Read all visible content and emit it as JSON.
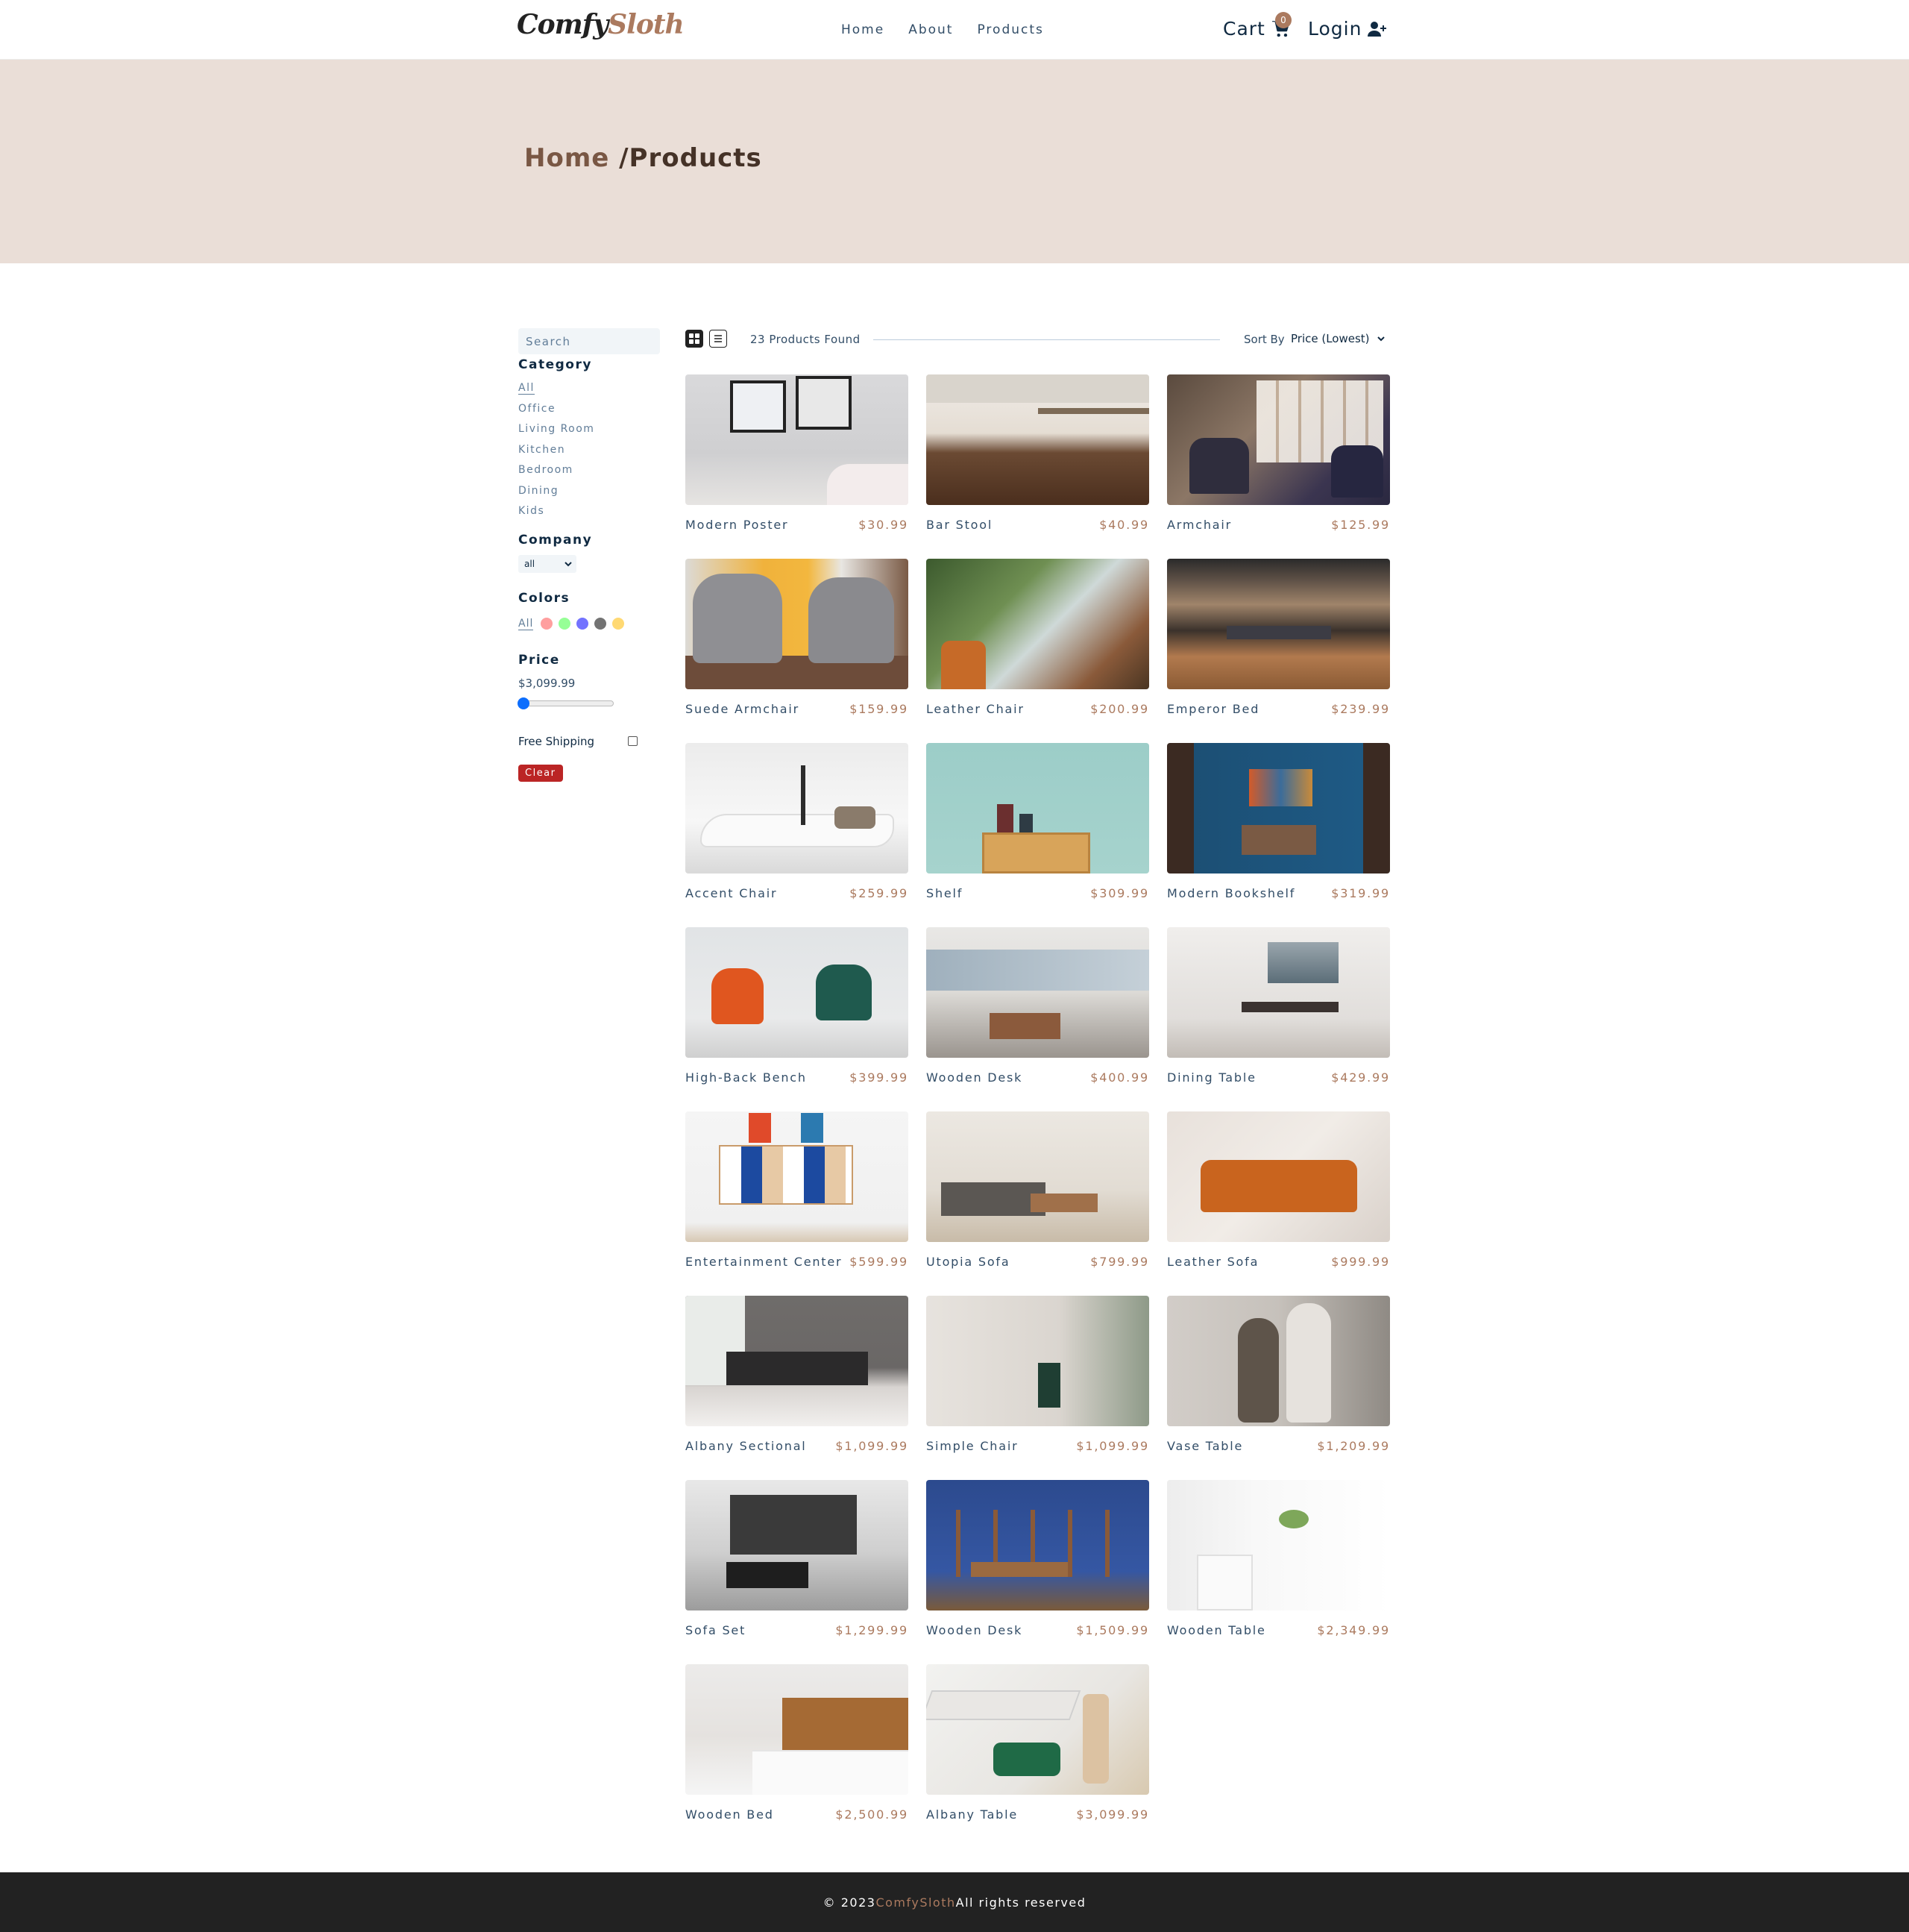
{
  "nav": {
    "logo_a": "Comfy",
    "logo_b": "Sloth",
    "links": [
      "Home",
      "About",
      "Products"
    ],
    "cart_label": "Cart",
    "cart_count": "0",
    "login_label": "Login"
  },
  "hero": {
    "crumb_home": "Home ",
    "crumb_current": "/Products"
  },
  "filters": {
    "search_placeholder": "Search",
    "category_heading": "Category",
    "categories": [
      "All",
      "Office",
      "Living Room",
      "Kitchen",
      "Bedroom",
      "Dining",
      "Kids"
    ],
    "company_heading": "Company",
    "company_value": "all",
    "colors_heading": "Colors",
    "colors_all": "All",
    "colors": [
      "#ff5050",
      "#40ff40",
      "#0000ff",
      "#000000",
      "#ffb900"
    ],
    "price_heading": "Price",
    "price_value": "$3,099.99",
    "price_slider_fraction": 0.0,
    "shipping_label": "Free Shipping",
    "clear_label": "Clear"
  },
  "sort": {
    "count_text": "23 Products Found",
    "sort_label": "Sort By",
    "sort_value": "Price (Lowest)"
  },
  "products": [
    {
      "name": "Modern Poster",
      "price": "$30.99"
    },
    {
      "name": "Bar Stool",
      "price": "$40.99"
    },
    {
      "name": "Armchair",
      "price": "$125.99"
    },
    {
      "name": "Suede Armchair",
      "price": "$159.99"
    },
    {
      "name": "Leather Chair",
      "price": "$200.99"
    },
    {
      "name": "Emperor Bed",
      "price": "$239.99"
    },
    {
      "name": "Accent Chair",
      "price": "$259.99"
    },
    {
      "name": "Shelf",
      "price": "$309.99"
    },
    {
      "name": "Modern Bookshelf",
      "price": "$319.99"
    },
    {
      "name": "High-Back Bench",
      "price": "$399.99"
    },
    {
      "name": "Wooden Desk",
      "price": "$400.99"
    },
    {
      "name": "Dining Table",
      "price": "$429.99"
    },
    {
      "name": "Entertainment Center",
      "price": "$599.99"
    },
    {
      "name": "Utopia Sofa",
      "price": "$799.99"
    },
    {
      "name": "Leather Sofa",
      "price": "$999.99"
    },
    {
      "name": "Albany Sectional",
      "price": "$1,099.99"
    },
    {
      "name": "Simple Chair",
      "price": "$1,099.99"
    },
    {
      "name": "Vase Table",
      "price": "$1,209.99"
    },
    {
      "name": "Sofa Set",
      "price": "$1,299.99"
    },
    {
      "name": "Wooden Desk",
      "price": "$1,509.99"
    },
    {
      "name": "Wooden Table",
      "price": "$2,349.99"
    },
    {
      "name": "Wooden Bed",
      "price": "$2,500.99"
    },
    {
      "name": "Albany Table",
      "price": "$3,099.99"
    }
  ],
  "footer": {
    "prefix": "© 2023",
    "brand": "ComfySloth",
    "suffix": " All rights reserved"
  }
}
